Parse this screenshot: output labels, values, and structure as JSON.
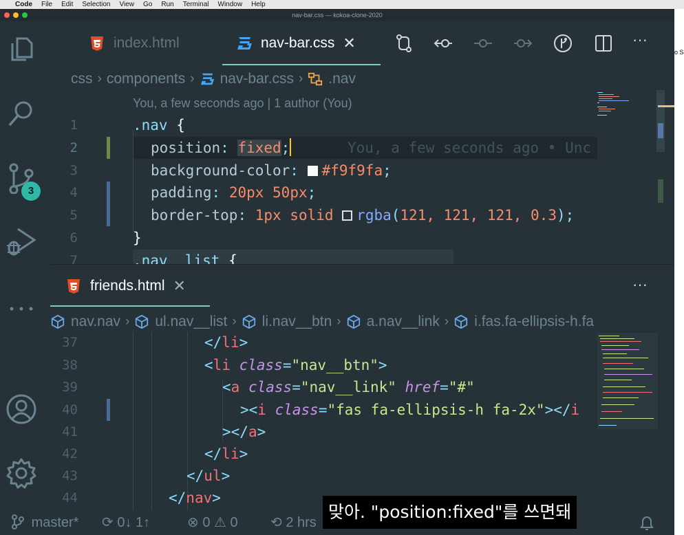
{
  "menubar": {
    "app": "Code",
    "items": [
      "File",
      "Edit",
      "Selection",
      "View",
      "Go",
      "Run",
      "Terminal",
      "Window",
      "Help"
    ]
  },
  "window": {
    "title": "nav-bar.css — kokoa-clone-2020",
    "edge_text": "o S"
  },
  "activity": {
    "scm_badge": "3",
    "icons": [
      "explorer-icon",
      "search-icon",
      "source-control-icon",
      "run-debug-icon",
      "more-icon",
      "account-icon",
      "settings-gear-icon"
    ]
  },
  "editor1": {
    "tabs": [
      {
        "label": "index.html",
        "active": false
      },
      {
        "label": "nav-bar.css",
        "active": true
      }
    ],
    "close_glyph": "✕",
    "more_glyph": "···",
    "breadcrumb": [
      "css",
      "components",
      "nav-bar.css",
      ".nav"
    ],
    "blame_header": "You, a few seconds ago | 1 author (You)",
    "inline_blame": "You, a few seconds ago • Unc",
    "line_numbers": [
      "1",
      "2",
      "3",
      "4",
      "5",
      "6",
      "7"
    ],
    "code": {
      "l1_sel": ".nav",
      "l1_brace": " {",
      "l2_prop": "position",
      "l2_val": "fixed",
      "l3_prop": "background-color",
      "l3_val": "#f9f9fa",
      "l4_prop": "padding",
      "l4_val": "20px 50px",
      "l5_prop": "border-top",
      "l5_v1": "1px solid ",
      "l5_fn": "rgba",
      "l5_args": "121, 121, 121, 0.3",
      "l6": "}",
      "l7_sel": ".nav__list",
      "l7_brace": " {"
    },
    "colors": {
      "swatch1": "#f9f9fa",
      "swatch2": "#797979"
    }
  },
  "editor2": {
    "tab": {
      "label": "friends.html"
    },
    "breadcrumb": [
      "nav.nav",
      "ul.nav__list",
      "li.nav__btn",
      "a.nav__link",
      "i.fas.fa-ellipsis-h.fa"
    ],
    "line_numbers": [
      "37",
      "38",
      "39",
      "40",
      "41",
      "42",
      "43",
      "44"
    ],
    "code": {
      "l37_tag": "li",
      "l38_tag": "li",
      "l38_attr": "class",
      "l38_str": "\"nav__btn\"",
      "l39_tag": "a",
      "l39_attr1": "class",
      "l39_str1": "\"nav__link\"",
      "l39_attr2": "href",
      "l39_str2": "\"#\"",
      "l40_tag": "i",
      "l40_attr": "class",
      "l40_str": "\"fas fa-ellipsis-h fa-2x\"",
      "l40_close": "i",
      "l41_tag": "a",
      "l42_tag": "li",
      "l43_tag": "ul",
      "l44_tag": "nav"
    }
  },
  "status": {
    "branch": "master*",
    "sync": "0↓ 1↑",
    "errors": "0",
    "warnings": "0",
    "blame": "2 hrs"
  },
  "subtitle": "맞아. \"position:fixed\"를 쓰면돼"
}
